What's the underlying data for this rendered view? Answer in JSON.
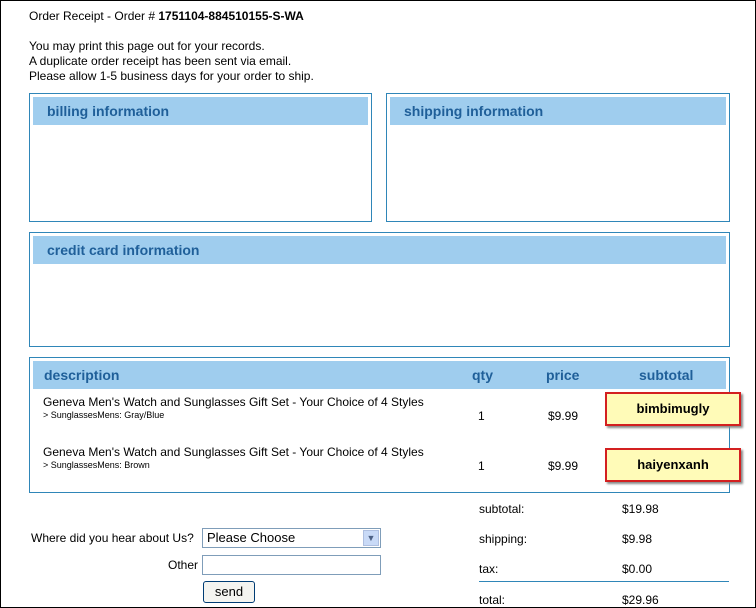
{
  "header": {
    "title_prefix": "Order Receipt - Order # ",
    "order_number": "1751104-884510155-S-WA",
    "notes": [
      "You may print this page out for your records.",
      "A duplicate order receipt has been sent via email.",
      "Please allow 1-5 business days for your order to ship."
    ]
  },
  "billing": {
    "title": "billing information"
  },
  "shipping": {
    "title": "shipping information"
  },
  "credit_card": {
    "title": "credit card information"
  },
  "items_table": {
    "headers": {
      "description": "description",
      "qty": "qty",
      "price": "price",
      "subtotal": "subtotal"
    },
    "rows": [
      {
        "title": "Geneva Men's Watch and Sunglasses Gift Set - Your Choice of 4 Styles",
        "option": "> SunglassesMens: Gray/Blue",
        "qty": "1",
        "price": "$9.99",
        "note": "bimbimugly"
      },
      {
        "title": "Geneva Men's Watch and Sunglasses Gift Set - Your Choice of 4 Styles",
        "option": "> SunglassesMens: Brown",
        "qty": "1",
        "price": "$9.99",
        "note": "haiyenxanh"
      }
    ]
  },
  "totals": {
    "subtotal_label": "subtotal:",
    "subtotal_value": "$19.98",
    "shipping_label": "shipping:",
    "shipping_value": "$9.98",
    "tax_label": "tax:",
    "tax_value": "$0.00",
    "total_label": "total:",
    "total_value": "$29.96"
  },
  "referral": {
    "question": "Where did you hear about Us?",
    "selected": "Please Choose",
    "other_label": "Other",
    "other_value": "",
    "send_label": "send"
  },
  "colors": {
    "panel_border": "#2f86b8",
    "panel_header_bg": "#9fcdee",
    "panel_header_text": "#1f5f99",
    "sticky_bg": "#fffbb8",
    "sticky_border": "#d32020"
  }
}
